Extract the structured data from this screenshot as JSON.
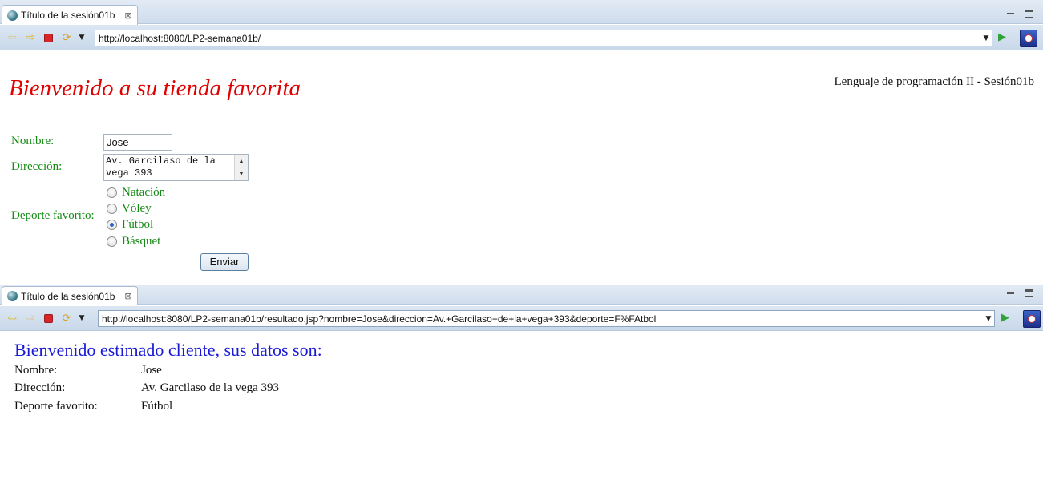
{
  "browser1": {
    "tab_title": "Título de la sesión01b",
    "tab_close": "⊠",
    "url": "http://localhost:8080/LP2-semana01b/"
  },
  "page1": {
    "welcome": "Bienvenido a su tienda favorita",
    "course": "Lenguaje de programación II - Sesión01b",
    "name_label": "Nombre:",
    "name_value": "Jose",
    "address_label": "Dirección:",
    "address_value": "Av. Garcilaso de la vega 393",
    "sport_label": "Deporte favorito:",
    "sports": [
      {
        "label": "Natación",
        "checked": false
      },
      {
        "label": "Vóley",
        "checked": false
      },
      {
        "label": "Fútbol",
        "checked": true
      },
      {
        "label": "Básquet",
        "checked": false
      }
    ],
    "submit_label": "Enviar"
  },
  "browser2": {
    "tab_title": "Título de la sesión01b",
    "tab_close": "⊠",
    "url": "http://localhost:8080/LP2-semana01b/resultado.jsp?nombre=Jose&direccion=Av.+Garcilaso+de+la+vega+393&deporte=F%FAtbol"
  },
  "page2": {
    "title": "Bienvenido estimado cliente, sus datos son:",
    "rows": [
      {
        "label": "Nombre:",
        "value": "Jose"
      },
      {
        "label": "Dirección:",
        "value": "Av. Garcilaso de la vega 393"
      },
      {
        "label": "Deporte favorito:",
        "value": "Fútbol"
      }
    ]
  },
  "colors": {
    "welcome": "#e00000",
    "form_label": "#138a13",
    "result_title": "#1a1ad6"
  },
  "icons": [
    "globe-icon",
    "close-icon",
    "minimize-icon",
    "maximize-icon",
    "back-icon",
    "forward-icon",
    "stop-icon",
    "refresh-icon",
    "dropdown-icon",
    "go-icon",
    "eclipse-icon"
  ]
}
